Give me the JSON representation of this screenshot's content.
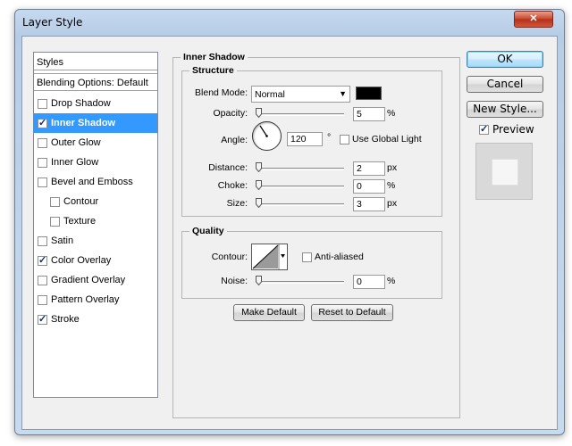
{
  "window": {
    "title": "Layer Style",
    "close_symbol": "✕"
  },
  "styles_list": {
    "header": "Styles",
    "blending_options": "Blending Options: Default",
    "items": [
      {
        "label": "Drop Shadow",
        "checked": false,
        "selected": false,
        "sub": false
      },
      {
        "label": "Inner Shadow",
        "checked": true,
        "selected": true,
        "sub": false
      },
      {
        "label": "Outer Glow",
        "checked": false,
        "selected": false,
        "sub": false
      },
      {
        "label": "Inner Glow",
        "checked": false,
        "selected": false,
        "sub": false
      },
      {
        "label": "Bevel and Emboss",
        "checked": false,
        "selected": false,
        "sub": false
      },
      {
        "label": "Contour",
        "checked": false,
        "selected": false,
        "sub": true
      },
      {
        "label": "Texture",
        "checked": false,
        "selected": false,
        "sub": true
      },
      {
        "label": "Satin",
        "checked": false,
        "selected": false,
        "sub": false
      },
      {
        "label": "Color Overlay",
        "checked": true,
        "selected": false,
        "sub": false
      },
      {
        "label": "Gradient Overlay",
        "checked": false,
        "selected": false,
        "sub": false
      },
      {
        "label": "Pattern Overlay",
        "checked": false,
        "selected": false,
        "sub": false
      },
      {
        "label": "Stroke",
        "checked": true,
        "selected": false,
        "sub": false
      }
    ]
  },
  "panel": {
    "title": "Inner Shadow",
    "structure": {
      "title": "Structure",
      "blend_mode_label": "Blend Mode:",
      "blend_mode_value": "Normal",
      "shadow_color": "#000000",
      "opacity_label": "Opacity:",
      "opacity_value": "5",
      "opacity_unit": "%",
      "angle_label": "Angle:",
      "angle_value": "120",
      "angle_unit": "°",
      "use_global_light_label": "Use Global Light",
      "distance_label": "Distance:",
      "distance_value": "2",
      "distance_unit": "px",
      "choke_label": "Choke:",
      "choke_value": "0",
      "choke_unit": "%",
      "size_label": "Size:",
      "size_value": "3",
      "size_unit": "px"
    },
    "quality": {
      "title": "Quality",
      "contour_label": "Contour:",
      "anti_aliased_label": "Anti-aliased",
      "noise_label": "Noise:",
      "noise_value": "0",
      "noise_unit": "%"
    },
    "make_default_label": "Make Default",
    "reset_default_label": "Reset to Default"
  },
  "side_buttons": {
    "ok_label": "OK",
    "cancel_label": "Cancel",
    "new_style_label": "New Style...",
    "preview_label": "Preview"
  }
}
